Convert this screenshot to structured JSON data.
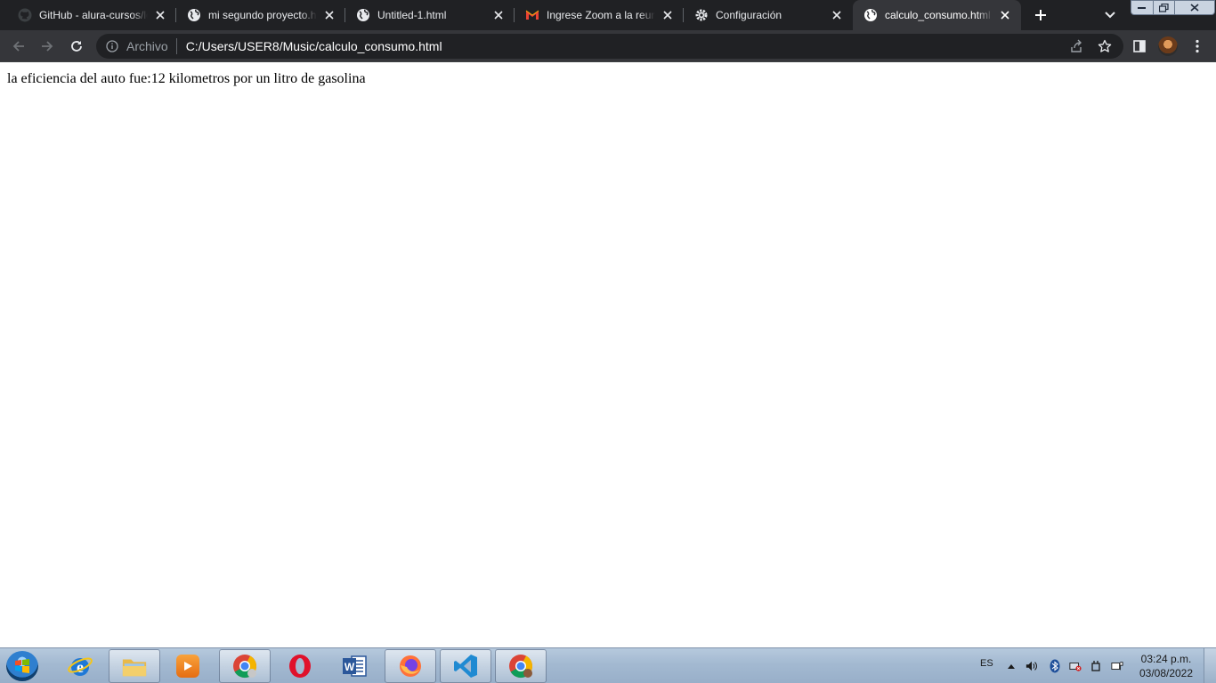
{
  "tabs": [
    {
      "title": "GitHub - alura-cursos/lo",
      "icon": "github-icon",
      "active": false
    },
    {
      "title": "mi segundo proyecto.ht",
      "icon": "globe-icon",
      "active": false
    },
    {
      "title": "Untitled-1.html",
      "icon": "globe-icon",
      "active": false
    },
    {
      "title": "Ingrese Zoom a la reuni",
      "icon": "gmail-icon",
      "active": false
    },
    {
      "title": "Configuración",
      "icon": "gear-icon",
      "active": false
    },
    {
      "title": "calculo_consumo.html",
      "icon": "globe-icon",
      "active": true
    }
  ],
  "omnibox": {
    "scheme_label": "Archivo",
    "url": "C:/Users/USER8/Music/calculo_consumo.html"
  },
  "page": {
    "result_text": "la eficiencia del auto fue:12 kilometros por un litro de gasolina"
  },
  "taskbar": {
    "apps": [
      {
        "name": "internet-explorer",
        "icon": "ie-icon",
        "running": false
      },
      {
        "name": "file-explorer",
        "icon": "folder-icon",
        "running": true
      },
      {
        "name": "media-player",
        "icon": "media-player-icon",
        "running": false
      },
      {
        "name": "chrome-profile",
        "icon": "chrome-icon",
        "running": true
      },
      {
        "name": "opera",
        "icon": "opera-icon",
        "running": false
      },
      {
        "name": "word",
        "icon": "word-icon",
        "running": false
      },
      {
        "name": "firefox",
        "icon": "firefox-icon",
        "running": true
      },
      {
        "name": "vscode",
        "icon": "vscode-icon",
        "running": true
      },
      {
        "name": "chrome",
        "icon": "chrome-icon",
        "running": true
      }
    ],
    "language": "ES",
    "clock_time": "03:24 p.m.",
    "clock_date": "03/08/2022"
  },
  "colors": {
    "tabstrip_bg": "#202124",
    "toolbar_bg": "#35363a",
    "omnibox_bg": "#202124",
    "taskbar_bg": "#a3b9d1"
  }
}
